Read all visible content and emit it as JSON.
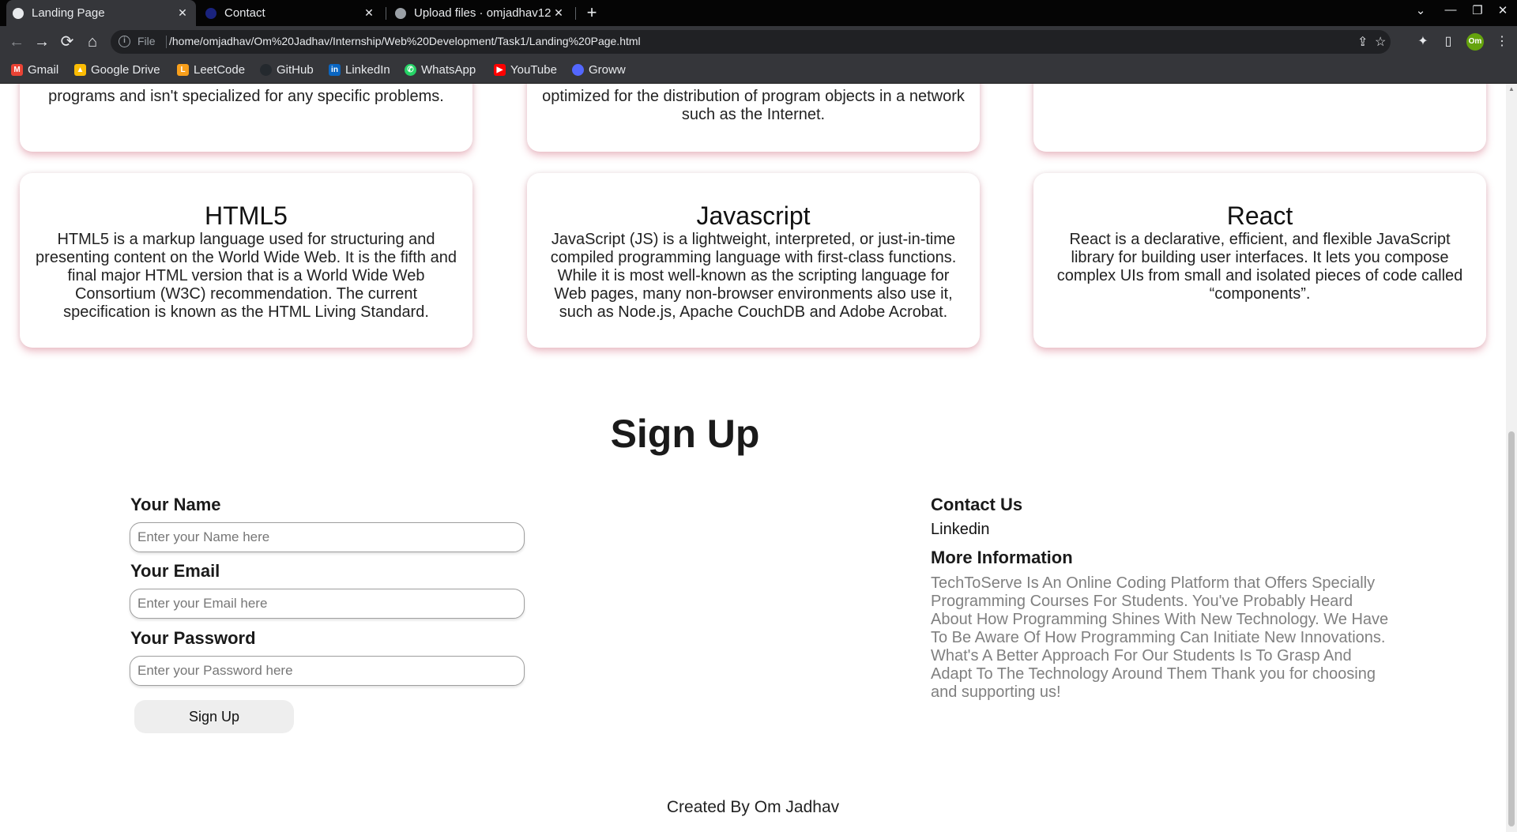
{
  "browser": {
    "tabs": [
      {
        "title": "Landing Page",
        "active": true
      },
      {
        "title": "Contact",
        "active": false
      },
      {
        "title": "Upload files · omjadhav12",
        "active": false
      }
    ],
    "address": {
      "scheme_label": "File",
      "url": "/home/omjadhav/Om%20Jadhav/Internship/Web%20Development/Task1/Landing%20Page.html"
    },
    "profile_initials": "Om",
    "bookmarks": [
      {
        "label": "Gmail",
        "icon_color": "#ea4335",
        "icon": "gmail-icon"
      },
      {
        "label": "Google Drive",
        "icon_color": "#fbbc04",
        "icon": "google-drive-icon"
      },
      {
        "label": "LeetCode",
        "icon_color": "#f89f1b",
        "icon": "leetcode-icon"
      },
      {
        "label": "GitHub",
        "icon_color": "#24292e",
        "icon": "github-icon"
      },
      {
        "label": "LinkedIn",
        "icon_color": "#0a66c2",
        "icon": "linkedin-icon"
      },
      {
        "label": "WhatsApp",
        "icon_color": "#25d366",
        "icon": "whatsapp-icon"
      },
      {
        "label": "YouTube",
        "icon_color": "#ff0000",
        "icon": "youtube-icon"
      },
      {
        "label": "Groww",
        "icon_color": "#5367ff",
        "icon": "groww-icon"
      }
    ]
  },
  "page": {
    "top_cards": [
      {
        "text": "programs and isn't specialized for any specific problems."
      },
      {
        "text": "optimized for the distribution of program objects in a network such as the Internet."
      },
      {
        "text": ""
      }
    ],
    "cards": [
      {
        "title": "HTML5",
        "text": "HTML5 is a markup language used for structuring and presenting content on the World Wide Web. It is the fifth and final major HTML version that is a World Wide Web Consortium (W3C) recommendation. The current specification is known as the HTML Living Standard."
      },
      {
        "title": "Javascript",
        "text": "JavaScript (JS) is a lightweight, interpreted, or just-in-time compiled programming language with first-class functions. While it is most well-known as the scripting language for Web pages, many non-browser environments also use it, such as Node.js, Apache CouchDB and Adobe Acrobat."
      },
      {
        "title": "React",
        "text": "React is a declarative, efficient, and flexible JavaScript library for building user interfaces. It lets you compose complex UIs from small and isolated pieces of code called “components”."
      }
    ],
    "signup": {
      "title": "Sign Up",
      "name_label": "Your Name",
      "name_placeholder": "Enter your Name here",
      "email_label": "Your Email",
      "email_placeholder": "Enter your Email here",
      "password_label": "Your Password",
      "password_placeholder": "Enter your Password here",
      "button_label": "Sign Up"
    },
    "contact": {
      "title": "Contact Us",
      "link": "Linkedin",
      "more_title": "More Information",
      "more_text": "TechToServe Is An Online Coding Platform that Offers Specially Programming Courses For Students. You've Probably Heard About How Programming Shines With New Technology. We Have To Be Aware Of How Programming Can Initiate New Innovations. What's A Better Approach For Our Students Is To Grasp And Adapt To The Technology Around Them Thank you for choosing and supporting us!"
    },
    "footer": "Created By Om Jadhav"
  }
}
